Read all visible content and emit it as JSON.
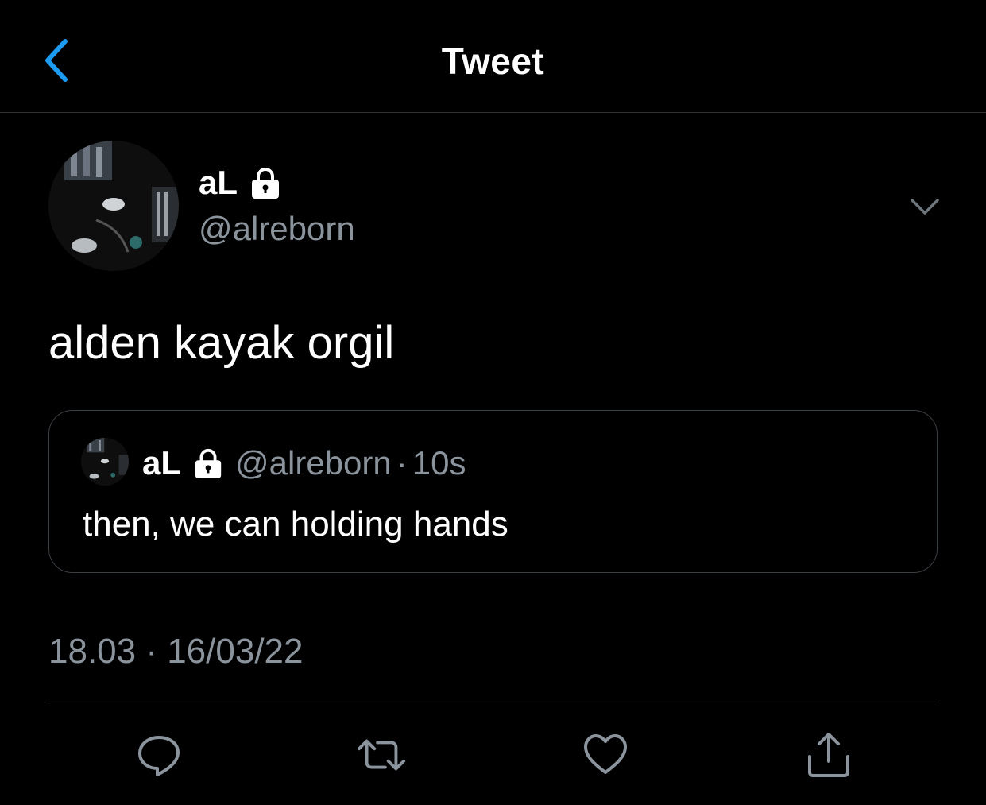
{
  "header": {
    "title": "Tweet",
    "back_icon": "chevron-left-icon"
  },
  "colors": {
    "accent": "#1d9bf0",
    "secondary_text": "#8b949c",
    "border": "#2f3336",
    "background": "#000000"
  },
  "tweet": {
    "display_name": "aL",
    "protected_icon": "lock-icon",
    "handle": "@alreborn",
    "text": "alden kayak orgil",
    "timestamp": "18.03 · 16/03/22"
  },
  "quote": {
    "display_name": "aL",
    "handle": "@alreborn",
    "separator": "·",
    "time": "10s",
    "text": "then, we can holding hands"
  },
  "actions": [
    {
      "icon": "reply-icon"
    },
    {
      "icon": "retweet-icon"
    },
    {
      "icon": "like-icon"
    },
    {
      "icon": "share-icon"
    }
  ]
}
